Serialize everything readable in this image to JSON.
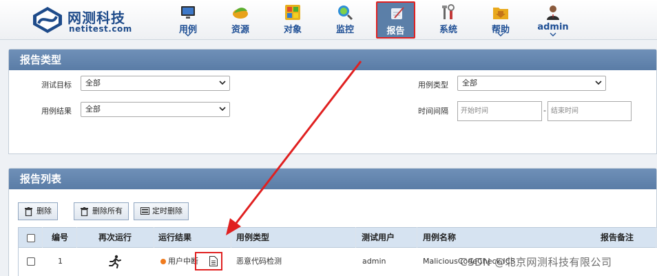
{
  "header": {
    "brand_name": "网测科技",
    "brand_sub": "netitest.com",
    "nav": [
      {
        "label": "用例",
        "icon": "monitor-icon",
        "has_dropdown": true
      },
      {
        "label": "资源",
        "icon": "leaf-disk-icon",
        "has_dropdown": false
      },
      {
        "label": "对象",
        "icon": "windows-logo-icon",
        "has_dropdown": false
      },
      {
        "label": "监控",
        "icon": "magnifier-globe-icon",
        "has_dropdown": false
      },
      {
        "label": "报告",
        "icon": "report-pen-icon",
        "has_dropdown": false,
        "active": true
      },
      {
        "label": "系统",
        "icon": "tools-icon",
        "has_dropdown": false
      },
      {
        "label": "帮助",
        "icon": "folder-download-icon",
        "has_dropdown": true
      },
      {
        "label": "admin",
        "icon": "user-icon",
        "has_dropdown": true
      }
    ]
  },
  "filter": {
    "title": "报告类型",
    "target_label": "测试目标",
    "target_value": "全部",
    "result_label": "用例结果",
    "result_value": "全部",
    "case_type_label": "用例类型",
    "case_type_value": "全部",
    "interval_label": "时间间隔",
    "start_placeholder": "开始时间",
    "range_sep": "-",
    "end_placeholder": "结束时间"
  },
  "list": {
    "title": "报告列表",
    "delete_label": "删除",
    "delete_all_label": "删除所有",
    "scheduled_delete_label": "定时删除",
    "columns": [
      "编号",
      "再次运行",
      "运行结果",
      "用例类型",
      "测试用户",
      "用例名称",
      "报告备注"
    ],
    "rows": [
      {
        "id": "1",
        "result": "用户中断",
        "case_type": "恶意代码检测",
        "user": "admin",
        "case_name": "MaliciousCodeCheck.ICS"
      }
    ]
  },
  "colors": {
    "accent": "#5a7ca6",
    "annotation": "#e02020",
    "status_orange": "#f07b1e"
  },
  "watermark": "CSDN @北京网测科技有限公司"
}
